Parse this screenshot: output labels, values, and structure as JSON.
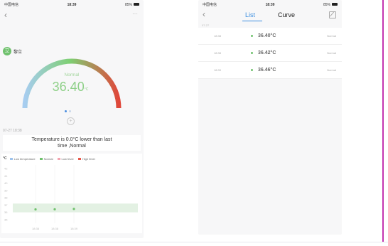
{
  "left": {
    "status": {
      "carrier": "中国电信",
      "time": "18:39",
      "battery": "85%"
    },
    "back_glyph": "‹",
    "more_glyph": "···",
    "user": {
      "avatar_char": "立",
      "name": "黎立"
    },
    "gauge": {
      "status": "Normal",
      "value": "36.40",
      "unit": "°C",
      "fraction": 0.55
    },
    "record_time": "07-27 18:38",
    "message": {
      "line1": "Temperature is 0.0°C lower than last",
      "line2": "time ,Normal"
    },
    "legend": {
      "unit": "°C",
      "items": [
        {
          "label": "Low temperature",
          "color": "#9ec3ec"
        },
        {
          "label": "Normal",
          "color": "#6fc16d"
        },
        {
          "label": "Low fever",
          "color": "#f4a3b0"
        },
        {
          "label": "High fever",
          "color": "#e8574a"
        }
      ]
    }
  },
  "right": {
    "status": {
      "carrier": "中国电信",
      "time": "18:39",
      "battery": "85%"
    },
    "back_glyph": "‹",
    "tabs": {
      "list": "List",
      "curve": "Curve"
    },
    "date_label": "07-27",
    "rows": [
      {
        "time": "18:38",
        "value": "36.40°C",
        "status": "Normal"
      },
      {
        "time": "18:38",
        "value": "36.42°C",
        "status": "Normal"
      },
      {
        "time": "18:39",
        "value": "36.46°C",
        "status": "Normal"
      }
    ]
  },
  "chart_data": {
    "type": "scatter",
    "title": "",
    "xlabel": "",
    "ylabel": "°C",
    "categories": [
      "18:38",
      "18:38",
      "18:39"
    ],
    "series": [
      {
        "name": "Normal",
        "values": [
          36.4,
          36.42,
          36.46
        ]
      }
    ],
    "yticks": [
      42,
      41,
      40,
      39,
      38,
      37,
      36,
      35
    ],
    "ylim": [
      34.5,
      42.5
    ],
    "normal_band": [
      36.0,
      37.2
    ],
    "point_color": "#6fc16d",
    "band_color": "#e3f1e3",
    "grid": false,
    "legend": "top"
  }
}
